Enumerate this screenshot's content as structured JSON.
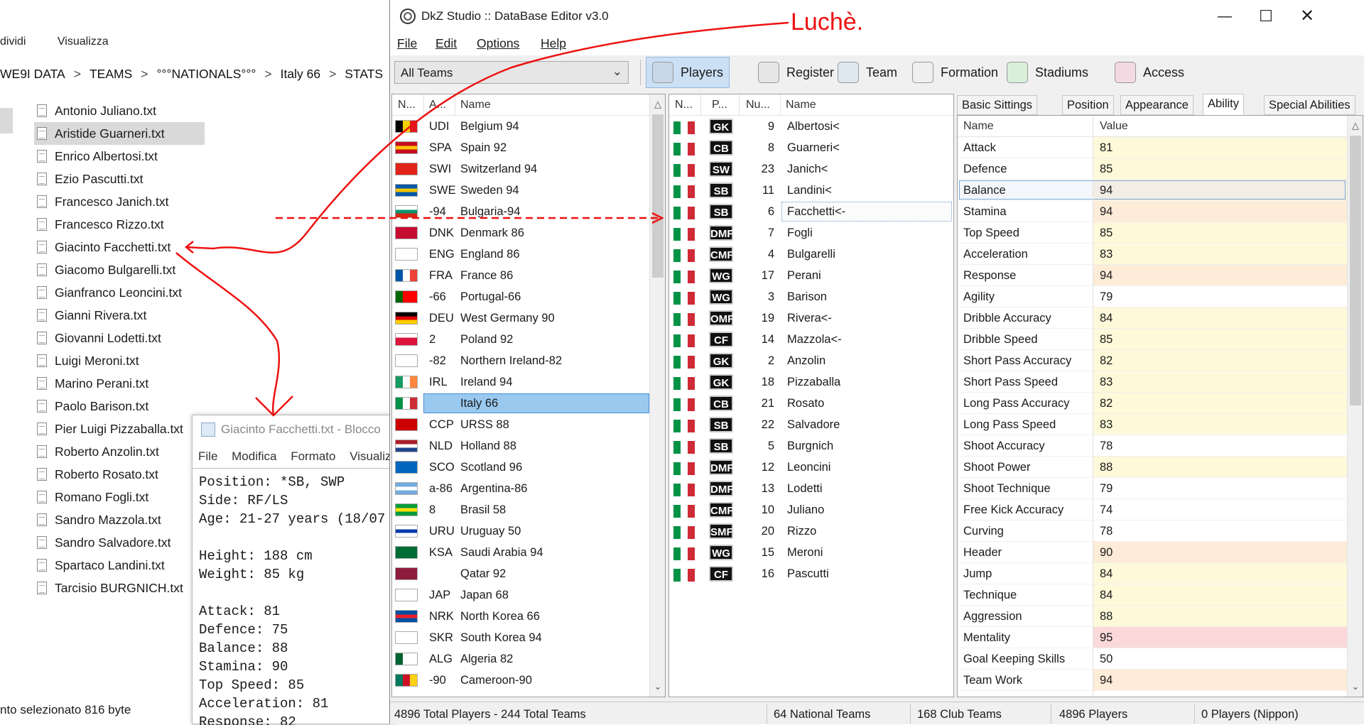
{
  "explorer": {
    "menu": [
      "dividi",
      "Visualizza"
    ],
    "breadcrumb": [
      "WE9I DATA",
      "TEAMS",
      "°°°NATIONALS°°°",
      "Italy 66",
      "STATS"
    ],
    "files": [
      "Antonio Juliano.txt",
      "Aristide Guarneri.txt",
      "Enrico Albertosi.txt",
      "Ezio Pascutti.txt",
      "Francesco Janich.txt",
      "Francesco Rizzo.txt",
      "Giacinto Facchetti.txt",
      "Giacomo Bulgarelli.txt",
      "Gianfranco Leoncini.txt",
      "Gianni Rivera.txt",
      "Giovanni Lodetti.txt",
      "Luigi Meroni.txt",
      "Marino Perani.txt",
      "Paolo Barison.txt",
      "Pier Luigi Pizzaballa.txt",
      "Roberto Anzolin.txt",
      "Roberto Rosato.txt",
      "Romano Fogli.txt",
      "Sandro Mazzola.txt",
      "Sandro Salvadore.txt",
      "Spartaco Landini.txt",
      "Tarcisio BURGNICH.txt"
    ],
    "selected_file": "Aristide Guarneri.txt",
    "status": "nto selezionato  816 byte"
  },
  "notepad": {
    "title": "Giacinto Facchetti.txt - Blocco",
    "menu": [
      "File",
      "Modifica",
      "Formato",
      "Visualizz"
    ],
    "lines": [
      "Position: *SB, SWP",
      "Side: RF/LS",
      "Age: 21-27 years (18/07",
      "",
      "Height: 188 cm",
      "Weight: 85 kg",
      "",
      "Attack: 81",
      "Defence: 75",
      "Balance: 88",
      "Stamina: 90",
      "Top Speed: 85",
      "Acceleration: 81",
      "Response: 82"
    ]
  },
  "app": {
    "title": "DkZ Studio :: DataBase Editor v3.0",
    "menu": [
      "File",
      "Edit",
      "Options",
      "Help"
    ],
    "team_filter": "All Teams",
    "toolbar": [
      {
        "label": "Players",
        "icon": "player-icon",
        "active": true
      },
      {
        "label": "Register",
        "icon": "register-icon",
        "active": false
      },
      {
        "label": "Team",
        "icon": "team-badge-icon",
        "active": false
      },
      {
        "label": "Formation",
        "icon": "formation-icon",
        "active": false
      },
      {
        "label": "Stadiums",
        "icon": "stadium-icon",
        "active": false
      },
      {
        "label": "Access",
        "icon": "access-icon",
        "active": false
      }
    ]
  },
  "teams": {
    "headers": [
      "N...",
      "A...",
      "Name"
    ],
    "selected": "Italy 66",
    "rows": [
      {
        "abbr": "UDI",
        "name": "Belgium 94",
        "flag": [
          "#000000",
          "#f5d000",
          "#e3171f"
        ],
        "dir": "v"
      },
      {
        "abbr": "SPA",
        "name": "Spain 92",
        "flag": [
          "#c60b1e",
          "#ffc400",
          "#c60b1e"
        ],
        "dir": "h"
      },
      {
        "abbr": "SWI",
        "name": "Switzerland 94",
        "flag": [
          "#e2231a",
          "#e2231a",
          "#e2231a"
        ],
        "dir": "h"
      },
      {
        "abbr": "SWE",
        "name": "Sweden 94",
        "flag": [
          "#005aa8",
          "#f5c400",
          "#005aa8"
        ],
        "dir": "h"
      },
      {
        "abbr": "-94",
        "name": "Bulgaria-94",
        "flag": [
          "#ffffff",
          "#00966e",
          "#d62612"
        ],
        "dir": "h"
      },
      {
        "abbr": "DNK",
        "name": "Denmark 86",
        "flag": [
          "#c60c30",
          "#c60c30",
          "#c60c30"
        ],
        "dir": "h"
      },
      {
        "abbr": "ENG",
        "name": "England 86",
        "flag": [
          "#ffffff",
          "#ffffff",
          "#ffffff"
        ],
        "dir": "h"
      },
      {
        "abbr": "FRA",
        "name": "France 86",
        "flag": [
          "#0055a4",
          "#ffffff",
          "#ef4135"
        ],
        "dir": "v"
      },
      {
        "abbr": "-66",
        "name": "Portugal-66",
        "flag": [
          "#006600",
          "#ff0000",
          "#ff0000"
        ],
        "dir": "v"
      },
      {
        "abbr": "DEU",
        "name": "West Germany 90",
        "flag": [
          "#000000",
          "#dd0000",
          "#ffce00"
        ],
        "dir": "h"
      },
      {
        "abbr": "2",
        "name": "Poland 92",
        "flag": [
          "#ffffff",
          "#dc143c",
          "#dc143c"
        ],
        "dir": "h"
      },
      {
        "abbr": "-82",
        "name": "Northern Ireland-82",
        "flag": [
          "#ffffff",
          "#ffffff",
          "#ffffff"
        ],
        "dir": "h"
      },
      {
        "abbr": "IRL",
        "name": "Ireland 94",
        "flag": [
          "#169b62",
          "#ffffff",
          "#ff883e"
        ],
        "dir": "v"
      },
      {
        "abbr": "",
        "name": "Italy 66",
        "flag": [
          "#009246",
          "#ffffff",
          "#ce2b37"
        ],
        "dir": "v"
      },
      {
        "abbr": "CCP",
        "name": "URSS 88",
        "flag": [
          "#cc0000",
          "#cc0000",
          "#cc0000"
        ],
        "dir": "h"
      },
      {
        "abbr": "NLD",
        "name": "Holland 88",
        "flag": [
          "#ae1c28",
          "#ffffff",
          "#21468b"
        ],
        "dir": "h"
      },
      {
        "abbr": "SCO",
        "name": "Scotland 96",
        "flag": [
          "#0065bd",
          "#0065bd",
          "#0065bd"
        ],
        "dir": "h"
      },
      {
        "abbr": "a-86",
        "name": "Argentina-86",
        "flag": [
          "#74acdf",
          "#ffffff",
          "#74acdf"
        ],
        "dir": "h"
      },
      {
        "abbr": "8",
        "name": "Brasil 58",
        "flag": [
          "#009c3b",
          "#ffdf00",
          "#009c3b"
        ],
        "dir": "h"
      },
      {
        "abbr": "URU",
        "name": "Uruguay 50",
        "flag": [
          "#ffffff",
          "#0038a8",
          "#ffffff"
        ],
        "dir": "h"
      },
      {
        "abbr": "KSA",
        "name": "Saudi Arabia 94",
        "flag": [
          "#006c35",
          "#006c35",
          "#006c35"
        ],
        "dir": "h"
      },
      {
        "abbr": "",
        "name": "Qatar 92",
        "flag": [
          "#8d1b3d",
          "#8d1b3d",
          "#8d1b3d"
        ],
        "dir": "h"
      },
      {
        "abbr": "JAP",
        "name": "Japan 68",
        "flag": [
          "#ffffff",
          "#ffffff",
          "#ffffff"
        ],
        "dir": "h"
      },
      {
        "abbr": "NRK",
        "name": "North Korea 66",
        "flag": [
          "#024fa2",
          "#ed1c27",
          "#024fa2"
        ],
        "dir": "h"
      },
      {
        "abbr": "SKR",
        "name": "South Korea 94",
        "flag": [
          "#ffffff",
          "#ffffff",
          "#ffffff"
        ],
        "dir": "h"
      },
      {
        "abbr": "ALG",
        "name": "Algeria 82",
        "flag": [
          "#006233",
          "#ffffff",
          "#ffffff"
        ],
        "dir": "v"
      },
      {
        "abbr": "-90",
        "name": "Cameroon-90",
        "flag": [
          "#007a5e",
          "#ce1126",
          "#fcd116"
        ],
        "dir": "v"
      }
    ]
  },
  "players": {
    "headers": [
      "N...",
      "P...",
      "Nu...",
      "Name"
    ],
    "selected": "Facchetti<-",
    "rows": [
      {
        "pos": "GK",
        "num": "9",
        "name": "Albertosi<"
      },
      {
        "pos": "CB",
        "num": "8",
        "name": "Guarneri<"
      },
      {
        "pos": "SW",
        "num": "23",
        "name": "Janich<"
      },
      {
        "pos": "SB",
        "num": "11",
        "name": "Landini<"
      },
      {
        "pos": "SB",
        "num": "6",
        "name": "Facchetti<-"
      },
      {
        "pos": "DMF",
        "num": "7",
        "name": "Fogli"
      },
      {
        "pos": "CMF",
        "num": "4",
        "name": "Bulgarelli"
      },
      {
        "pos": "WG",
        "num": "17",
        "name": "Perani"
      },
      {
        "pos": "WG",
        "num": "3",
        "name": "Barison"
      },
      {
        "pos": "OMF",
        "num": "19",
        "name": "Rivera<-"
      },
      {
        "pos": "CF",
        "num": "14",
        "name": "Mazzola<-"
      },
      {
        "pos": "GK",
        "num": "2",
        "name": "Anzolin"
      },
      {
        "pos": "GK",
        "num": "18",
        "name": "Pizzaballa"
      },
      {
        "pos": "CB",
        "num": "21",
        "name": "Rosato"
      },
      {
        "pos": "SB",
        "num": "22",
        "name": "Salvadore"
      },
      {
        "pos": "SB",
        "num": "5",
        "name": "Burgnich"
      },
      {
        "pos": "DMF",
        "num": "12",
        "name": "Leoncini"
      },
      {
        "pos": "DMF",
        "num": "13",
        "name": "Lodetti"
      },
      {
        "pos": "CMF",
        "num": "10",
        "name": "Juliano"
      },
      {
        "pos": "SMF",
        "num": "20",
        "name": "Rizzo"
      },
      {
        "pos": "WG",
        "num": "15",
        "name": "Meroni"
      },
      {
        "pos": "CF",
        "num": "16",
        "name": "Pascutti"
      }
    ]
  },
  "tabs": [
    "Basic Sittings",
    "Position",
    "Appearance",
    "Ability",
    "Special Abilities"
  ],
  "active_tab": "Ability",
  "ability": {
    "headers": [
      "Name",
      "Value"
    ],
    "selected": "Balance",
    "rows": [
      {
        "name": "Attack",
        "value": "81",
        "color": "#fdf9d9"
      },
      {
        "name": "Defence",
        "value": "85",
        "color": "#fdf9d9"
      },
      {
        "name": "Balance",
        "value": "94",
        "color": "#fdf0dc"
      },
      {
        "name": "Stamina",
        "value": "94",
        "color": "#fdecd8"
      },
      {
        "name": "Top Speed",
        "value": "85",
        "color": "#fdf9d9"
      },
      {
        "name": "Acceleration",
        "value": "83",
        "color": "#fdf9d9"
      },
      {
        "name": "Response",
        "value": "94",
        "color": "#fdecd8"
      },
      {
        "name": "Agility",
        "value": "79",
        "color": "#ffffff"
      },
      {
        "name": "Dribble Accuracy",
        "value": "84",
        "color": "#fdf9d9"
      },
      {
        "name": "Dribble Speed",
        "value": "85",
        "color": "#fdf9d9"
      },
      {
        "name": "Short Pass Accuracy",
        "value": "82",
        "color": "#fdf9d9"
      },
      {
        "name": "Short Pass Speed",
        "value": "83",
        "color": "#fdf9d9"
      },
      {
        "name": "Long Pass Accuracy",
        "value": "82",
        "color": "#fdf9d9"
      },
      {
        "name": "Long Pass Speed",
        "value": "83",
        "color": "#fdf9d9"
      },
      {
        "name": "Shoot Accuracy",
        "value": "78",
        "color": "#ffffff"
      },
      {
        "name": "Shoot Power",
        "value": "88",
        "color": "#fdf9d9"
      },
      {
        "name": "Shoot Technique",
        "value": "79",
        "color": "#ffffff"
      },
      {
        "name": "Free Kick Accuracy",
        "value": "74",
        "color": "#ffffff"
      },
      {
        "name": "Curving",
        "value": "78",
        "color": "#ffffff"
      },
      {
        "name": "Header",
        "value": "90",
        "color": "#fdecd8"
      },
      {
        "name": "Jump",
        "value": "84",
        "color": "#fdf9d9"
      },
      {
        "name": "Technique",
        "value": "84",
        "color": "#fdf9d9"
      },
      {
        "name": "Aggression",
        "value": "88",
        "color": "#fdf9d9"
      },
      {
        "name": "Mentality",
        "value": "95",
        "color": "#fbd9d9"
      },
      {
        "name": "Goal Keeping Skills",
        "value": "50",
        "color": "#ffffff"
      },
      {
        "name": "Team Work",
        "value": "94",
        "color": "#fdecd8"
      }
    ]
  },
  "status": [
    "4896 Total Players  -  244 Total Teams",
    "64 National Teams",
    "168 Club Teams",
    "4896 Players",
    "0 Players (Nippon)"
  ],
  "annotation": {
    "text": "Luchè.",
    "color": "#e11111"
  },
  "colors": {
    "selection": "#99c9ef",
    "active_tool": "#cce0f5",
    "italy_green": "#009246",
    "italy_red": "#ce2b37"
  }
}
